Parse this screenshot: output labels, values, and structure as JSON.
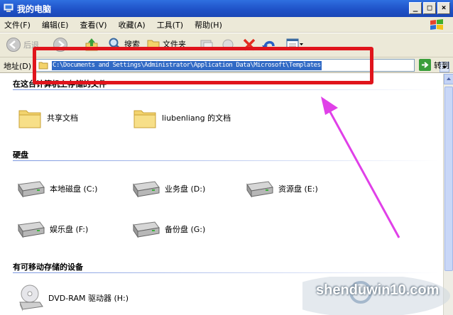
{
  "window": {
    "title": "我的电脑"
  },
  "menu": [
    "文件(F)",
    "编辑(E)",
    "查看(V)",
    "收藏(A)",
    "工具(T)",
    "帮助(H)"
  ],
  "toolbar": {
    "back_label": "后退",
    "search_label": "搜索",
    "folders_label": "文件夹"
  },
  "address": {
    "label": "地址(D)",
    "value": "C:\\Documents and Settings\\Administrator\\Application Data\\Microsoft\\Templates",
    "go_label": "转到"
  },
  "sections": {
    "shared_title": "在这台计算机上存储的文件",
    "shared_items": [
      "共享文档",
      "liubenliang 的文档"
    ],
    "drives_title": "硬盘",
    "drives": [
      "本地磁盘 (C:)",
      "业务盘 (D:)",
      "资源盘 (E:)",
      "娱乐盘 (F:)",
      "备份盘 (G:)"
    ],
    "removable_title": "有可移动存储的设备",
    "removable": [
      "DVD-RAM 驱动器 (H:)"
    ]
  },
  "watermark": {
    "text": "shenduwin10.com"
  },
  "colors": {
    "title_bar": "#1f52c8",
    "selection": "#316ac5",
    "annotation_red": "#e0141c",
    "annotation_pink": "#e040e8"
  }
}
